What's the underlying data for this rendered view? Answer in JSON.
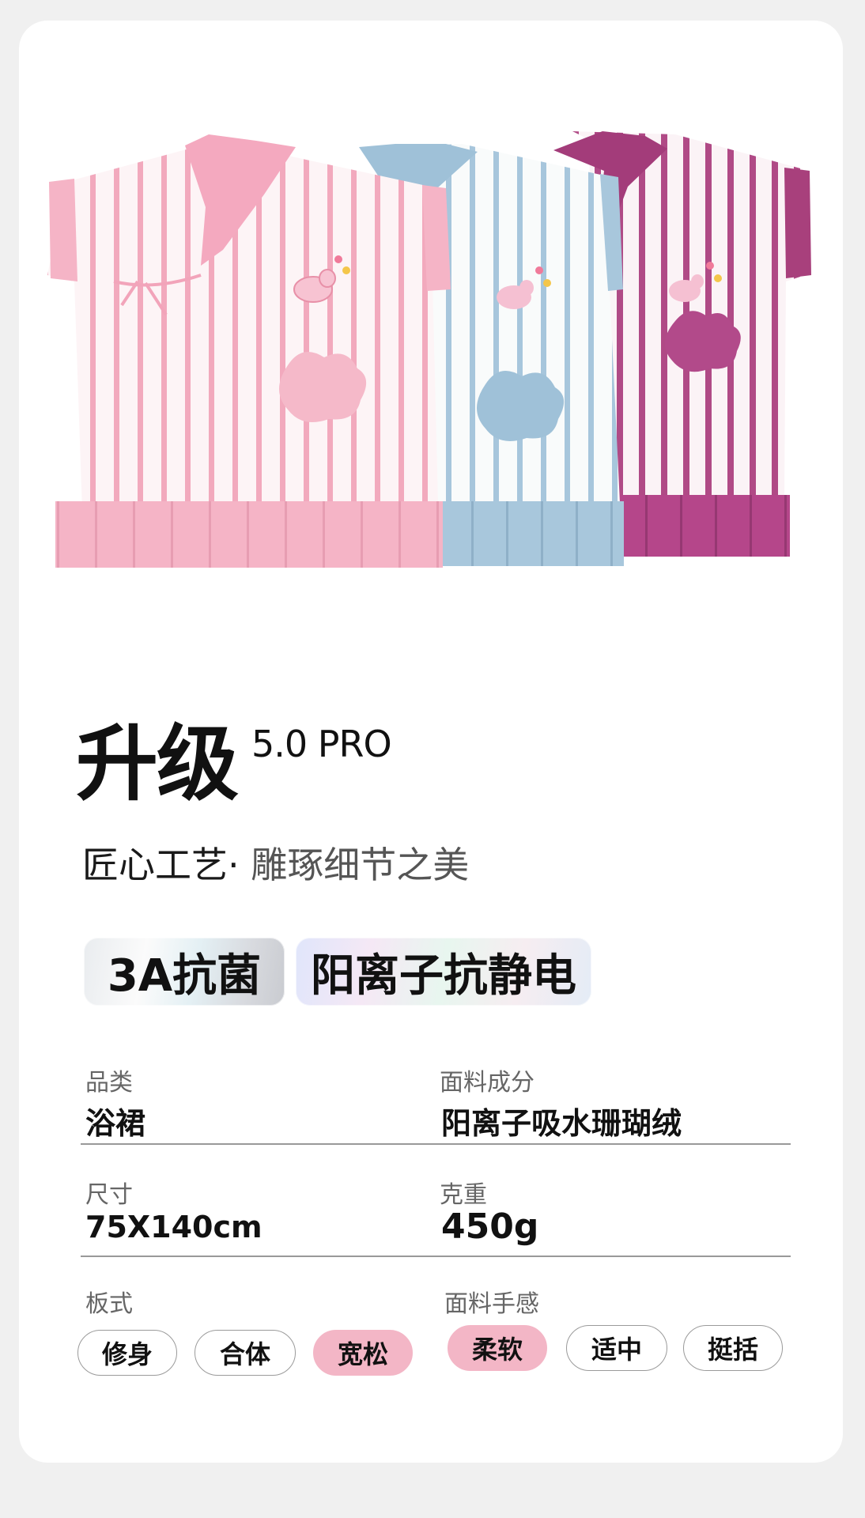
{
  "product_image": {
    "description_icon": "three-striped-bath-robes-image",
    "colors": {
      "pink": "#f4b8c8",
      "blue": "#a8c6dc",
      "plum": "#b8508e"
    }
  },
  "title": {
    "main": "升级",
    "sup": "5.0 PRO"
  },
  "subtitle": {
    "part1": "匠心工艺·",
    "part2": " 雕琢细节之美"
  },
  "badges": [
    "3A抗菌",
    "阳离子抗静电"
  ],
  "specs": {
    "category": {
      "label": "品类",
      "value": "浴裙"
    },
    "fabric": {
      "label": "面料成分",
      "value": "阳离子吸水珊瑚绒"
    },
    "size": {
      "label": "尺寸",
      "value": "75X140cm"
    },
    "weight": {
      "label": "克重",
      "value": "450g"
    },
    "fit": {
      "label": "板式",
      "options": [
        "修身",
        "合体",
        "宽松"
      ],
      "selected": "宽松"
    },
    "feel": {
      "label": "面料手感",
      "options": [
        "柔软",
        "适中",
        "挺括"
      ],
      "selected": "柔软"
    }
  },
  "accent_color": "#f3b6c6"
}
